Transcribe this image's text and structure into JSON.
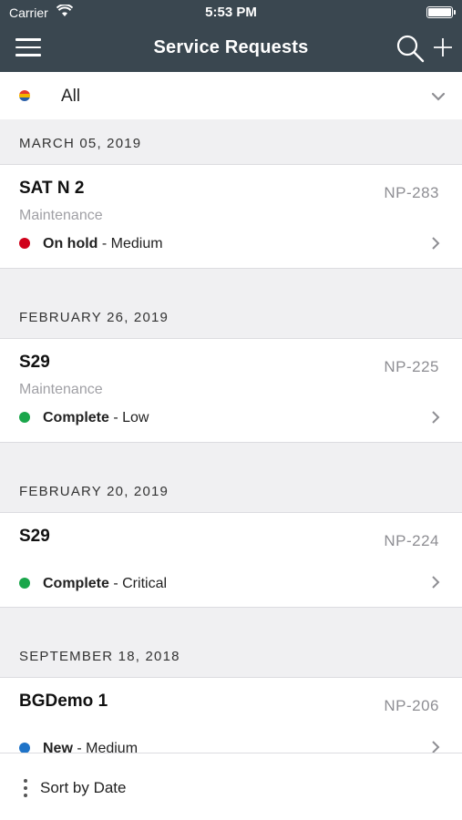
{
  "status_bar": {
    "carrier": "Carrier",
    "time": "5:53 PM"
  },
  "nav": {
    "title": "Service Requests",
    "menu_icon": "hamburger-icon",
    "search_icon": "search-icon",
    "add_icon": "plus-icon"
  },
  "filter": {
    "label": "All"
  },
  "sections": [
    {
      "date": "MARCH 05, 2019",
      "items": [
        {
          "name": "SAT N 2",
          "type": "Maintenance",
          "number": "NP-283",
          "status": "On hold",
          "priority": " - Medium",
          "status_color": "#d0021b"
        }
      ]
    },
    {
      "date": "FEBRUARY 26, 2019",
      "items": [
        {
          "name": "S29",
          "type": "Maintenance",
          "number": "NP-225",
          "status": "Complete",
          "priority": " - Low",
          "status_color": "#1aa64b"
        }
      ]
    },
    {
      "date": "FEBRUARY 20, 2019",
      "items": [
        {
          "name": "S29",
          "type": "",
          "number": "NP-224",
          "status": "Complete",
          "priority": " - Critical",
          "status_color": "#1aa64b"
        }
      ]
    },
    {
      "date": "SEPTEMBER 18, 2018",
      "items": [
        {
          "name": "BGDemo 1",
          "type": "",
          "number": "NP-206",
          "status": "New",
          "priority": " - Medium",
          "status_color": "#1e73c8"
        }
      ]
    }
  ],
  "bottom": {
    "sort_label": "Sort by Date"
  }
}
